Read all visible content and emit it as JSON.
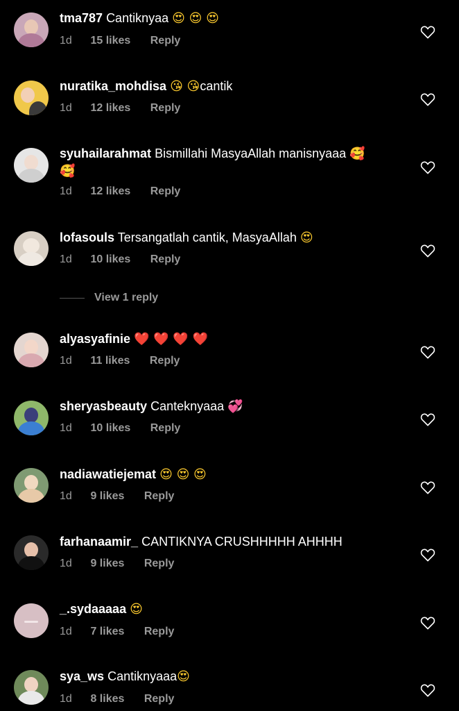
{
  "colors": {
    "background": "#000000",
    "text": "#ffffff",
    "secondary": "#9a9a9a",
    "emoji_face": "#ffcc2f",
    "emoji_heart": "#e8283a"
  },
  "comments": [
    {
      "username": "tma787",
      "text": "Cantiknyaa",
      "emoji": "😍 😍 😍",
      "time": "1d",
      "likes": "15 likes",
      "reply": "Reply",
      "avatar": "avatar-photo",
      "emoji_kind": "face-emoji"
    },
    {
      "username": "nuratika_mohdisa",
      "text": "",
      "emoji": "😘 😘",
      "text_after": "cantik",
      "time": "1d",
      "likes": "12 likes",
      "reply": "Reply",
      "avatar": "avatar-photo",
      "emoji_kind": "face-emoji"
    },
    {
      "username": "syuhailarahmat",
      "text": "Bismillahi MasyaAllah manisnyaaa",
      "emoji": "🥰",
      "line2": "🥰",
      "time": "1d",
      "likes": "12 likes",
      "reply": "Reply",
      "avatar": "avatar-photo",
      "emoji_kind": "face-emoji"
    },
    {
      "username": "lofasouls",
      "text": "Tersangatlah cantik, MasyaAllah",
      "emoji": "😍",
      "time": "1d",
      "likes": "10 likes",
      "reply": "Reply",
      "avatar": "avatar-photo",
      "emoji_kind": "face-emoji"
    },
    {
      "username": "alyasyafinie",
      "text": "",
      "emoji": "❤️ ❤️ ❤️ ❤️",
      "time": "1d",
      "likes": "11 likes",
      "reply": "Reply",
      "avatar": "avatar-photo",
      "emoji_kind": "heart"
    },
    {
      "username": "sheryasbeauty",
      "text": "Canteknyaaa",
      "emoji": "💞",
      "time": "1d",
      "likes": "10 likes",
      "reply": "Reply",
      "avatar": "avatar-photo",
      "emoji_kind": "hearts2"
    },
    {
      "username": "nadiawatiejemat",
      "text": "",
      "emoji": "😍 😍 😍",
      "time": "1d",
      "likes": "9 likes",
      "reply": "Reply",
      "avatar": "avatar-photo",
      "emoji_kind": "face-emoji"
    },
    {
      "username": "farhanaamir_",
      "text": "CANTIKNYA CRUSHHHHH AHHHH",
      "emoji": "",
      "time": "1d",
      "likes": "9 likes",
      "reply": "Reply",
      "avatar": "avatar-photo",
      "emoji_kind": "face-emoji"
    },
    {
      "username": "_.sydaaaaa",
      "text": "",
      "emoji": "😍",
      "time": "1d",
      "likes": "7 likes",
      "reply": "Reply",
      "avatar": "avatar-photo",
      "emoji_kind": "face-emoji"
    },
    {
      "username": "sya_ws",
      "text": "Cantiknyaaa",
      "emoji": "😍",
      "time": "1d",
      "likes": "8 likes",
      "reply": "Reply",
      "avatar": "avatar-photo",
      "emoji_kind": "face-emoji"
    }
  ],
  "view_replies": "View 1 reply"
}
